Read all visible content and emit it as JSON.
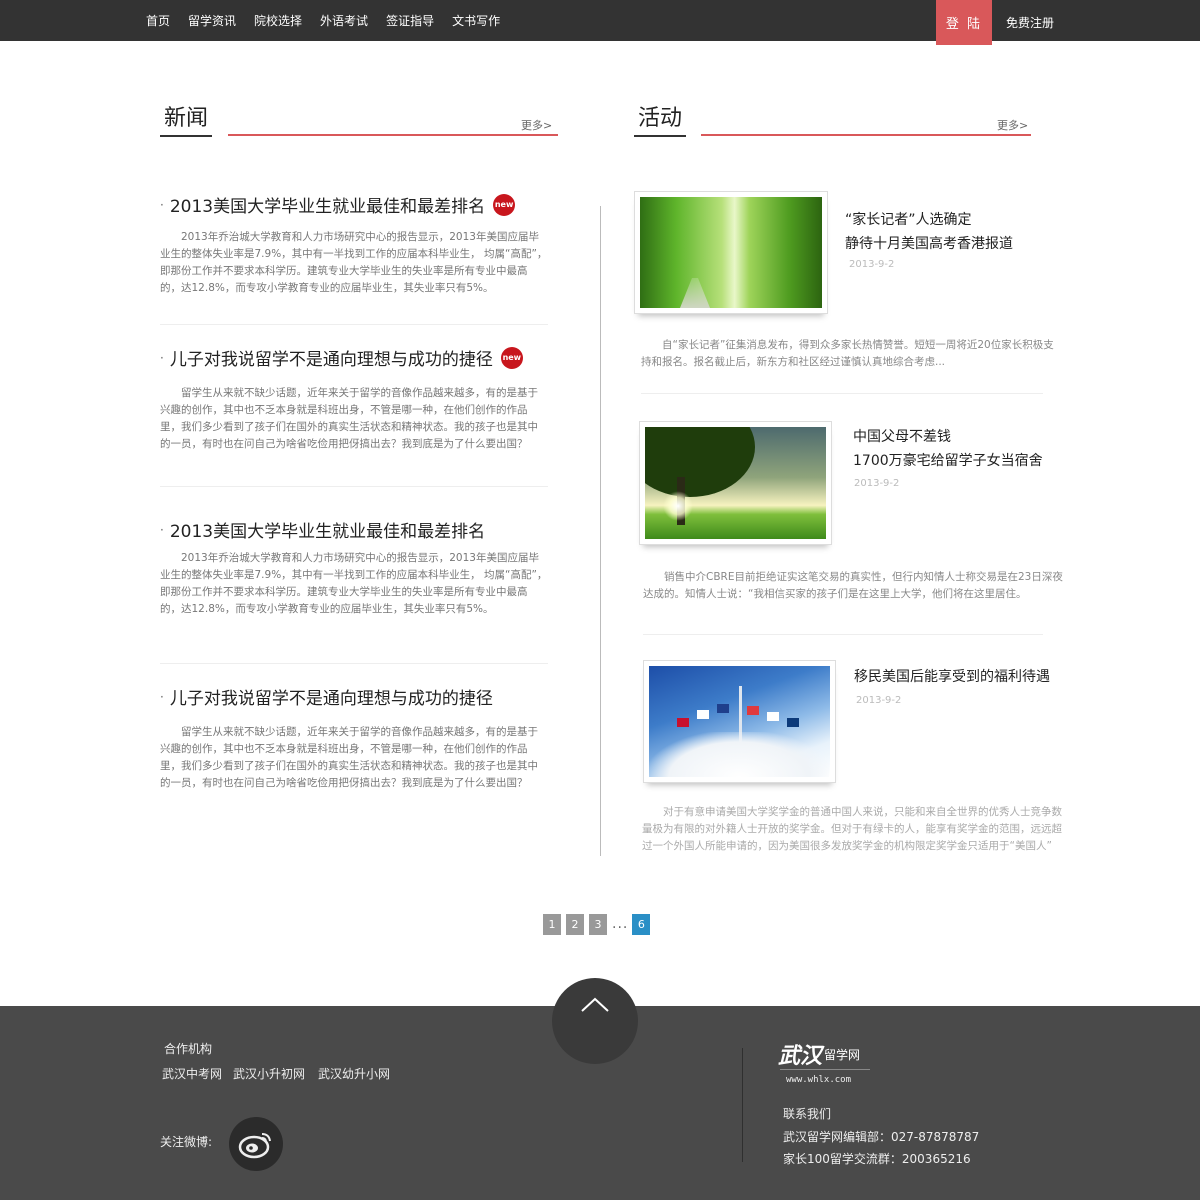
{
  "nav": {
    "items": [
      "首页",
      "留学资讯",
      "院校选择",
      "外语考试",
      "签证指导",
      "文书写作"
    ],
    "login": "登 陆",
    "register": "免费注册"
  },
  "news": {
    "title": "新闻",
    "more": "更多>",
    "items": [
      {
        "title": "2013美国大学毕业生就业最佳和最差排名",
        "badge": "new",
        "body": "2013年乔治城大学教育和人力市场研究中心的报告显示，2013年美国应届毕业生的整体失业率是7.9%，其中有一半找到工作的应届本科毕业生， 均属“高配”，即那份工作并不要求本科学历。建筑专业大学毕业生的失业率是所有专业中最高的，达12.8%，而专攻小学教育专业的应届毕业生，其失业率只有5%。"
      },
      {
        "title": "儿子对我说留学不是通向理想与成功的捷径",
        "badge": "new",
        "body": "留学生从来就不缺少话题，近年来关于留学的音像作品越来越多，有的是基于兴趣的创作，其中也不乏本身就是科班出身，不管是哪一种，在他们创作的作品里，我们多少看到了孩子们在国外的真实生活状态和精神状态。我的孩子也是其中的一员，有时也在问自己为啥省吃俭用把伢搞出去？我到底是为了什么要出国？"
      },
      {
        "title": "2013美国大学毕业生就业最佳和最差排名",
        "body": "2013年乔治城大学教育和人力市场研究中心的报告显示，2013年美国应届毕业生的整体失业率是7.9%，其中有一半找到工作的应届本科毕业生， 均属“高配”，即那份工作并不要求本科学历。建筑专业大学毕业生的失业率是所有专业中最高的，达12.8%，而专攻小学教育专业的应届毕业生，其失业率只有5%。"
      },
      {
        "title": "儿子对我说留学不是通向理想与成功的捷径",
        "body": "留学生从来就不缺少话题，近年来关于留学的音像作品越来越多，有的是基于兴趣的创作，其中也不乏本身就是科班出身，不管是哪一种，在他们创作的作品里，我们多少看到了孩子们在国外的真实生活状态和精神状态。我的孩子也是其中的一员，有时也在问自己为啥省吃俭用把伢搞出去？我到底是为了什么要出国？"
      }
    ]
  },
  "activities": {
    "title": "活动",
    "more": "更多>",
    "items": [
      {
        "title_line1": "“家长记者”人选确定",
        "title_line2": "静待十月美国高考香港报道",
        "date": "2013-9-2",
        "image": "bamboo-forest-path",
        "desc": "自“家长记者”征集消息发布，得到众多家长热情赞誉。短短一周将近20位家长积极支持和报名。报名截止后，新东方和社区经过谨慎认真地综合考虑..."
      },
      {
        "title_line1": "中国父母不差钱",
        "title_line2": "1700万豪宅给留学子女当宿舍",
        "date": "2013-9-2",
        "image": "tree-sunset-park",
        "desc": "销售中介CBRE目前拒绝证实这笔交易的真实性，但行内知情人士称交易是在23日深夜达成的。知情人士说：“我相信买家的孩子们是在这里上大学，他们将在这里居住。"
      },
      {
        "title_line1": "移民美国后能享受到的福利待遇",
        "title_line2": "",
        "date": "2013-9-2",
        "image": "flags-blue-sky",
        "desc": "对于有意申请美国大学奖学金的普通中国人来说，只能和来自全世界的优秀人士竞争数量极为有限的对外籍人士开放的奖学金。但对于有绿卡的人，能享有奖学金的范围，远远超过一个外国人所能申请的，因为美国很多发放奖学金的机构限定奖学金只适用于“美国人”"
      }
    ]
  },
  "pagination": {
    "pages": [
      "1",
      "2",
      "3"
    ],
    "ellipsis": "...",
    "current": "6"
  },
  "footer": {
    "partners_label": "合作机构",
    "partners": [
      "武汉中考网",
      "武汉小升初网",
      "武汉幼升小网"
    ],
    "follow_label": "关注微博:",
    "logo_main": "武汉",
    "logo_sub": "留学网",
    "logo_url": "www.whlx.com",
    "contact_label": "联系我们",
    "contact_line1": "武汉留学网编辑部：027-87878787",
    "contact_line2": "家长100留学交流群：200365216"
  },
  "colors": {
    "accent": "#d9585a",
    "nav_bg": "#333333",
    "footer_bg": "#4a4a4a",
    "badge": "#c8161d",
    "page_active": "#2a8fc6"
  }
}
